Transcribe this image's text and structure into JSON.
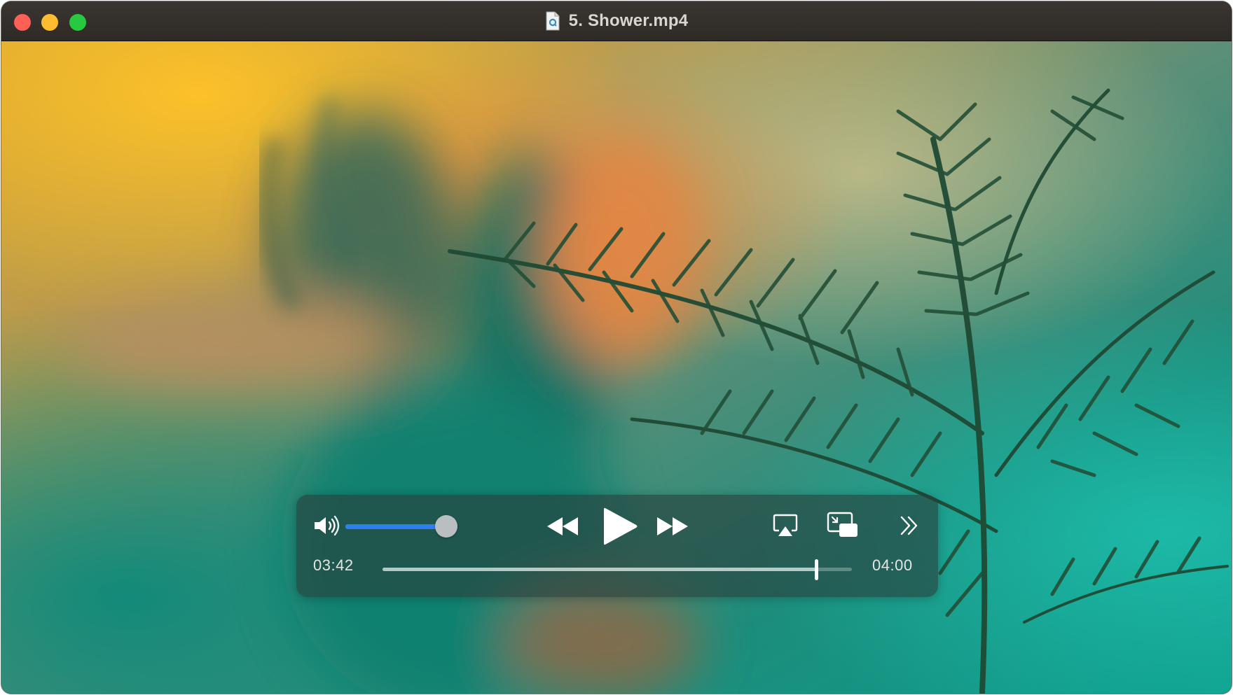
{
  "window": {
    "title": "5. Shower.mp4",
    "traffic_lights": {
      "close_color": "#fe5f57",
      "minimize_color": "#febc2e",
      "maximize_color": "#28c840"
    },
    "title_icon": "video-document-icon"
  },
  "player": {
    "volume_level": 0.92,
    "volume_icon": "speaker-volume-icon",
    "rewind_icon": "rewind-icon",
    "play_icon": "play-icon",
    "fast_forward_icon": "fast-forward-icon",
    "airplay_icon": "airplay-icon",
    "pip_icon": "picture-in-picture-icon",
    "more_icon": "double-chevron-right-icon",
    "current_time": "03:42",
    "duration": "04:00",
    "progress": 0.925,
    "accent_color": "#2d7ef0"
  }
}
